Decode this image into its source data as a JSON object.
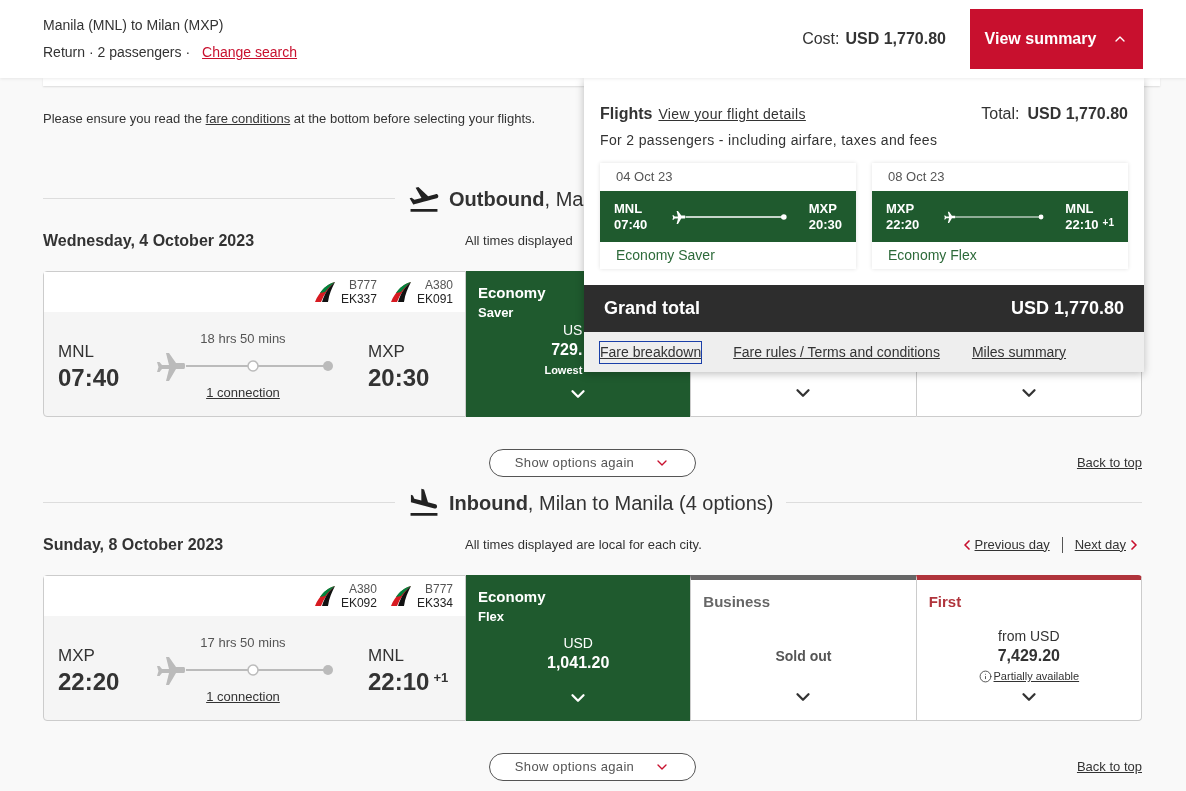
{
  "header": {
    "route": "Manila (MNL) to Milan (MXP)",
    "trip": "Return · 2 passengers ·",
    "change_link": "Change search",
    "cost_label": "Cost:",
    "cost": "USD 1,770.80",
    "summary_button": {
      "label": "View summary",
      "expanded": true
    }
  },
  "notice": {
    "before": "Please ensure you read the ",
    "link": "fare conditions",
    "after": " at the bottom before selecting your flights."
  },
  "sections": [
    {
      "kind": "outbound",
      "title": "**Outbound**, Ma",
      "date": "Wednesday, 4 October 2023",
      "times_note": "All times displayed",
      "flight": {
        "aircraft": [
          {
            "type": "B777",
            "flight": "EK337"
          },
          {
            "type": "A380",
            "flight": "EK091"
          }
        ],
        "from": "MNL",
        "dep": "07:40",
        "duration": "18 hrs 50 mins",
        "connection": "1 connection",
        "to": "MXP",
        "arr": "20:30"
      },
      "fares": [
        {
          "kind": "price",
          "selected": true,
          "cabin": "Economy",
          "fare": "Saver",
          "currency": "US",
          "price": "729.",
          "note": "Lowest"
        },
        {
          "kind": "covered",
          "selected": false
        },
        {
          "kind": "covered",
          "selected": false
        }
      ],
      "show_options": "Show options again",
      "back_to_top": "Back to top"
    },
    {
      "kind": "inbound",
      "title": "**Inbound**, Milan to Manila (4 options)",
      "date": "Sunday, 8 October 2023",
      "times_note": "All times displayed are local for each city.",
      "day_links": [
        {
          "kind": "previous",
          "label": "Previous day"
        },
        {
          "kind": "next",
          "label": "Next day"
        }
      ],
      "flight": {
        "aircraft": [
          {
            "type": "A380",
            "flight": "EK092"
          },
          {
            "type": "B777",
            "flight": "EK334"
          }
        ],
        "from": "MXP",
        "dep": "22:20",
        "duration": "17 hrs 50 mins",
        "connection": "1 connection",
        "to": "MNL",
        "arr": "22:10",
        "day_offset": "+1"
      },
      "fares": [
        {
          "kind": "price",
          "selected": true,
          "cabin": "Economy",
          "fare": "Flex",
          "currency": "USD",
          "price": "1,041.20"
        },
        {
          "kind": "sold_out",
          "selected": false,
          "cabin": "Business",
          "color": "#666666",
          "status": "Sold out"
        },
        {
          "kind": "price",
          "selected": false,
          "cabin": "First",
          "color": "#b0343c",
          "currency": "from USD",
          "price": "7,429.20",
          "availability": "Partially available"
        }
      ],
      "show_options": "Show options again",
      "back_to_top": "Back to top"
    }
  ],
  "summary": {
    "title": "Flights",
    "details_link": "View your flight details",
    "total_label": "Total:",
    "total": "USD 1,770.80",
    "subtitle": "For 2 passengers - including airfare, taxes and fees",
    "legs": [
      {
        "date": "04 Oct 23",
        "from": "MNL",
        "dep": "07:40",
        "to": "MXP",
        "arr": "20:30",
        "fare": "Economy Saver"
      },
      {
        "date": "08 Oct 23",
        "from": "MXP",
        "dep": "22:20",
        "to": "MNL",
        "arr": "22:10",
        "day_offset": "+1",
        "fare": "Economy Flex"
      }
    ],
    "grand_total_label": "Grand total",
    "grand_total": "USD 1,770.80",
    "links": [
      {
        "label": "Fare breakdown",
        "focused": true
      },
      {
        "label": "Fare rules / Terms and conditions",
        "focused": false
      },
      {
        "label": "Miles summary",
        "focused": false
      }
    ]
  }
}
